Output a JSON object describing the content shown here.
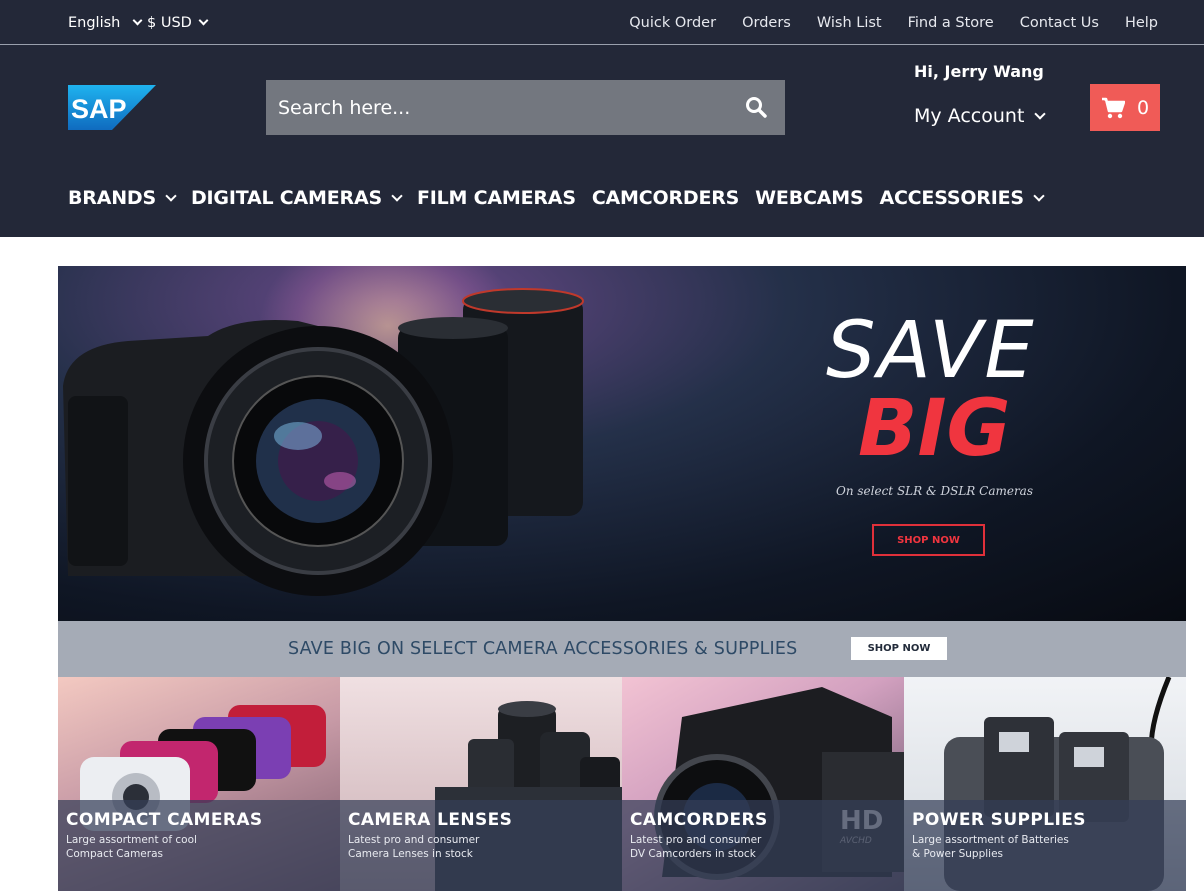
{
  "topbar": {
    "language": "English",
    "currency": "$ USD",
    "links": [
      "Quick Order",
      "Orders",
      "Wish List",
      "Find a Store",
      "Contact Us",
      "Help"
    ]
  },
  "header": {
    "logo_text": "SAP",
    "search_placeholder": "Search here...",
    "greeting": "Hi, Jerry Wang",
    "account_label": "My Account",
    "cart_count": "0"
  },
  "nav": [
    {
      "label": "BRANDS",
      "dropdown": true
    },
    {
      "label": "DIGITAL CAMERAS",
      "dropdown": true
    },
    {
      "label": "FILM CAMERAS",
      "dropdown": false
    },
    {
      "label": "CAMCORDERS",
      "dropdown": false
    },
    {
      "label": "WEBCAMS",
      "dropdown": false
    },
    {
      "label": "ACCESSORIES",
      "dropdown": true
    }
  ],
  "hero": {
    "headline": "SAVE",
    "headline_accent": "BIG",
    "subtitle": "On select SLR & DSLR Cameras",
    "cta": "SHOP NOW"
  },
  "strip": {
    "text": "SAVE BIG ON SELECT CAMERA ACCESSORIES & SUPPLIES",
    "cta": "SHOP NOW"
  },
  "tiles": [
    {
      "title": "COMPACT CAMERAS",
      "desc1": "Large assortment of cool",
      "desc2": "Compact Cameras"
    },
    {
      "title": "CAMERA LENSES",
      "desc1": "Latest pro and consumer",
      "desc2": "Camera Lenses in stock"
    },
    {
      "title": "CAMCORDERS",
      "desc1": "Latest pro and consumer",
      "desc2": "DV Camcorders in stock"
    },
    {
      "title": "POWER SUPPLIES",
      "desc1": "Large assortment of Batteries",
      "desc2": "& Power Supplies"
    }
  ],
  "colors": {
    "header_bg": "#232838",
    "cart_bg": "#f05b57",
    "accent_red": "#f0353f",
    "strip_bg": "#a5abb6"
  }
}
